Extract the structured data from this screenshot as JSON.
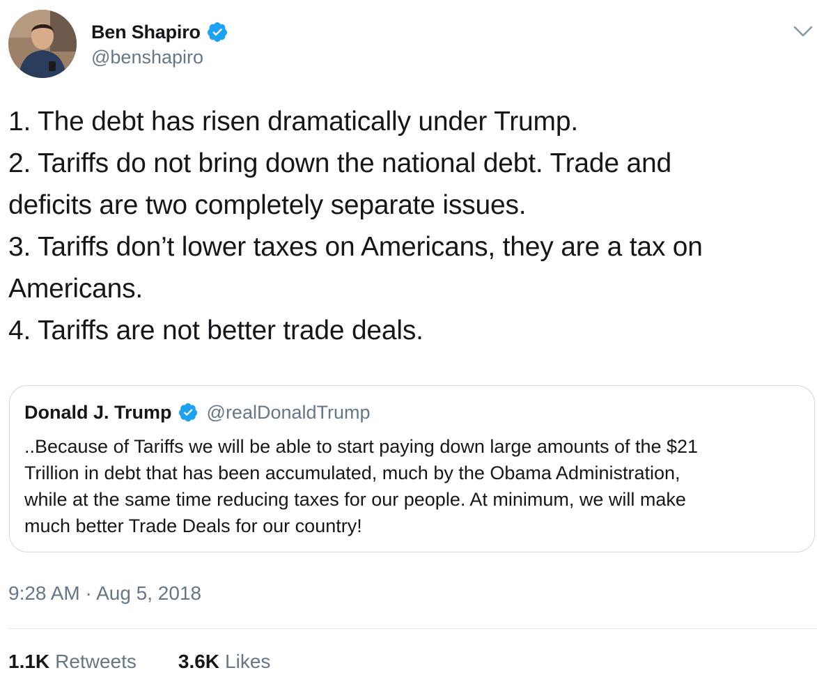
{
  "author": {
    "display_name": "Ben Shapiro",
    "handle": "@benshapiro",
    "verified": true,
    "avatar_icon": "profile-photo"
  },
  "tweet": {
    "lines": [
      "1. The debt has risen dramatically under Trump.",
      "2. Tariffs do not bring down the national debt. Trade and",
      "deficits are two completely separate issues.",
      "3. Tariffs don’t lower taxes on Americans, they are a tax on",
      "Americans.",
      "4. Tariffs are not better trade deals."
    ]
  },
  "quoted_tweet": {
    "display_name": "Donald J. Trump",
    "handle": "@realDonaldTrump",
    "verified": true,
    "lines": [
      "..Because of Tariffs we will be able to start paying down large amounts of the $21",
      "Trillion in debt that has been accumulated, much by the Obama Administration,",
      "while at the same time reducing taxes for our people. At minimum, we will make",
      "much better Trade Deals for our country!"
    ]
  },
  "timestamp": "9:28 AM · Aug 5, 2018",
  "stats": {
    "retweets_count": "1.1K",
    "retweets_label": "Retweets",
    "likes_count": "3.6K",
    "likes_label": "Likes"
  },
  "colors": {
    "verified_blue": "#1da1f2",
    "secondary_text": "#657786",
    "primary_text": "#14171a",
    "border": "#cfd9de"
  },
  "icons": {
    "verified": "verified-badge-icon",
    "menu": "chevron-down-icon"
  }
}
